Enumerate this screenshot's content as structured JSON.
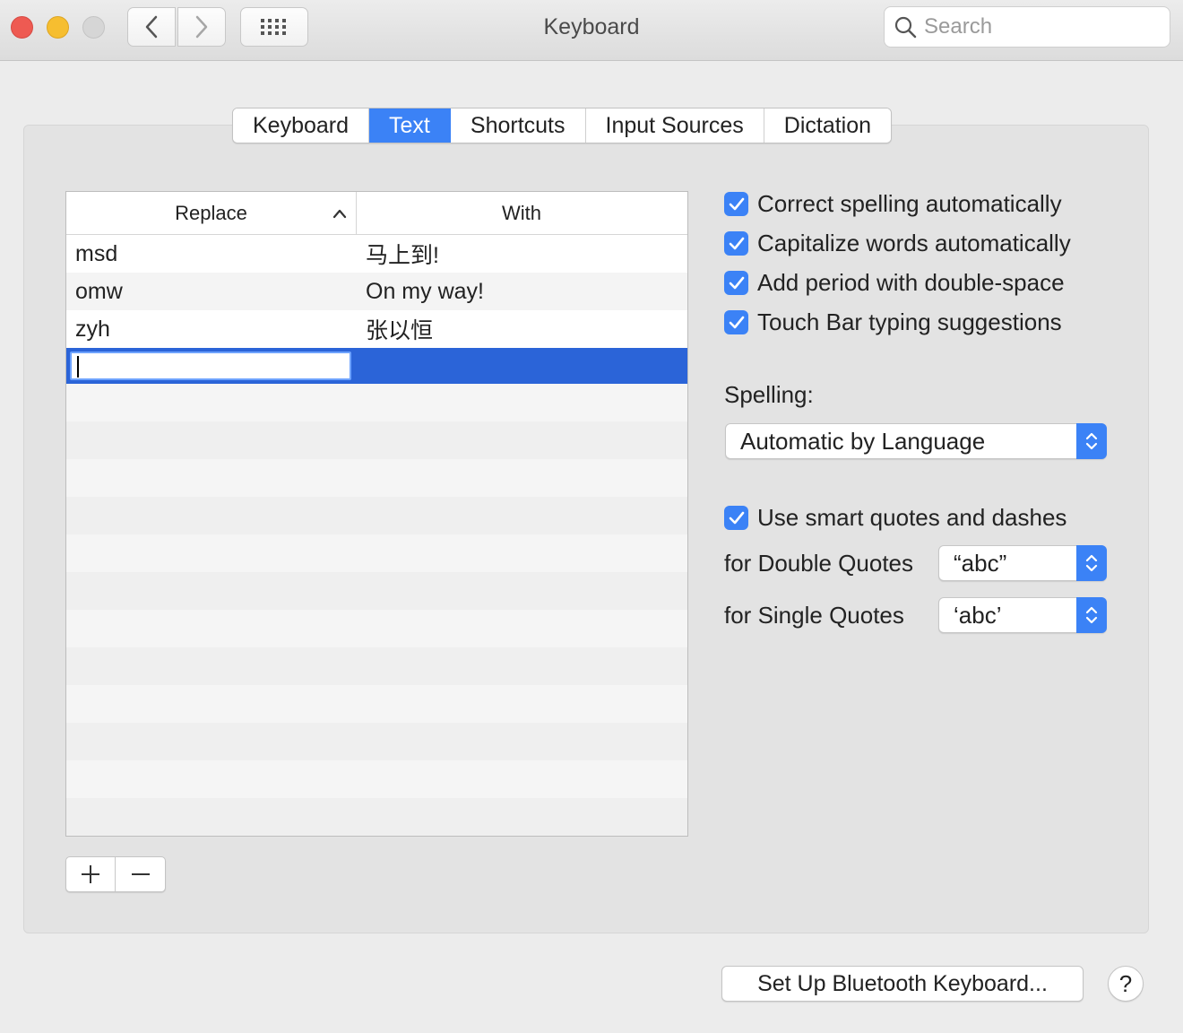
{
  "window": {
    "title": "Keyboard"
  },
  "search": {
    "placeholder": "Search"
  },
  "tabs": [
    {
      "label": "Keyboard"
    },
    {
      "label": "Text",
      "active": true
    },
    {
      "label": "Shortcuts"
    },
    {
      "label": "Input Sources"
    },
    {
      "label": "Dictation"
    }
  ],
  "table": {
    "headers": {
      "replace": "Replace",
      "with": "With"
    },
    "rows": [
      {
        "replace": "msd",
        "with": "马上到!"
      },
      {
        "replace": "omw",
        "with": "On my way!"
      },
      {
        "replace": "zyh",
        "with": "张以恒"
      }
    ],
    "editing_row": {
      "replace": "",
      "with": ""
    }
  },
  "options": {
    "correct_spelling": {
      "label": "Correct spelling automatically",
      "checked": true
    },
    "capitalize_words": {
      "label": "Capitalize words automatically",
      "checked": true
    },
    "add_period": {
      "label": "Add period with double-space",
      "checked": true
    },
    "touch_bar": {
      "label": "Touch Bar typing suggestions",
      "checked": true
    },
    "smart_quotes": {
      "label": "Use smart quotes and dashes",
      "checked": true
    }
  },
  "spelling": {
    "label": "Spelling:",
    "value": "Automatic by Language"
  },
  "double_quotes": {
    "label": "for Double Quotes",
    "value": "“abc”"
  },
  "single_quotes": {
    "label": "for Single Quotes",
    "value": "‘abc’"
  },
  "buttons": {
    "bluetooth": "Set Up Bluetooth Keyboard...",
    "help": "?"
  },
  "colors": {
    "accent": "#3b82f6",
    "selection": "#2b64d8"
  }
}
